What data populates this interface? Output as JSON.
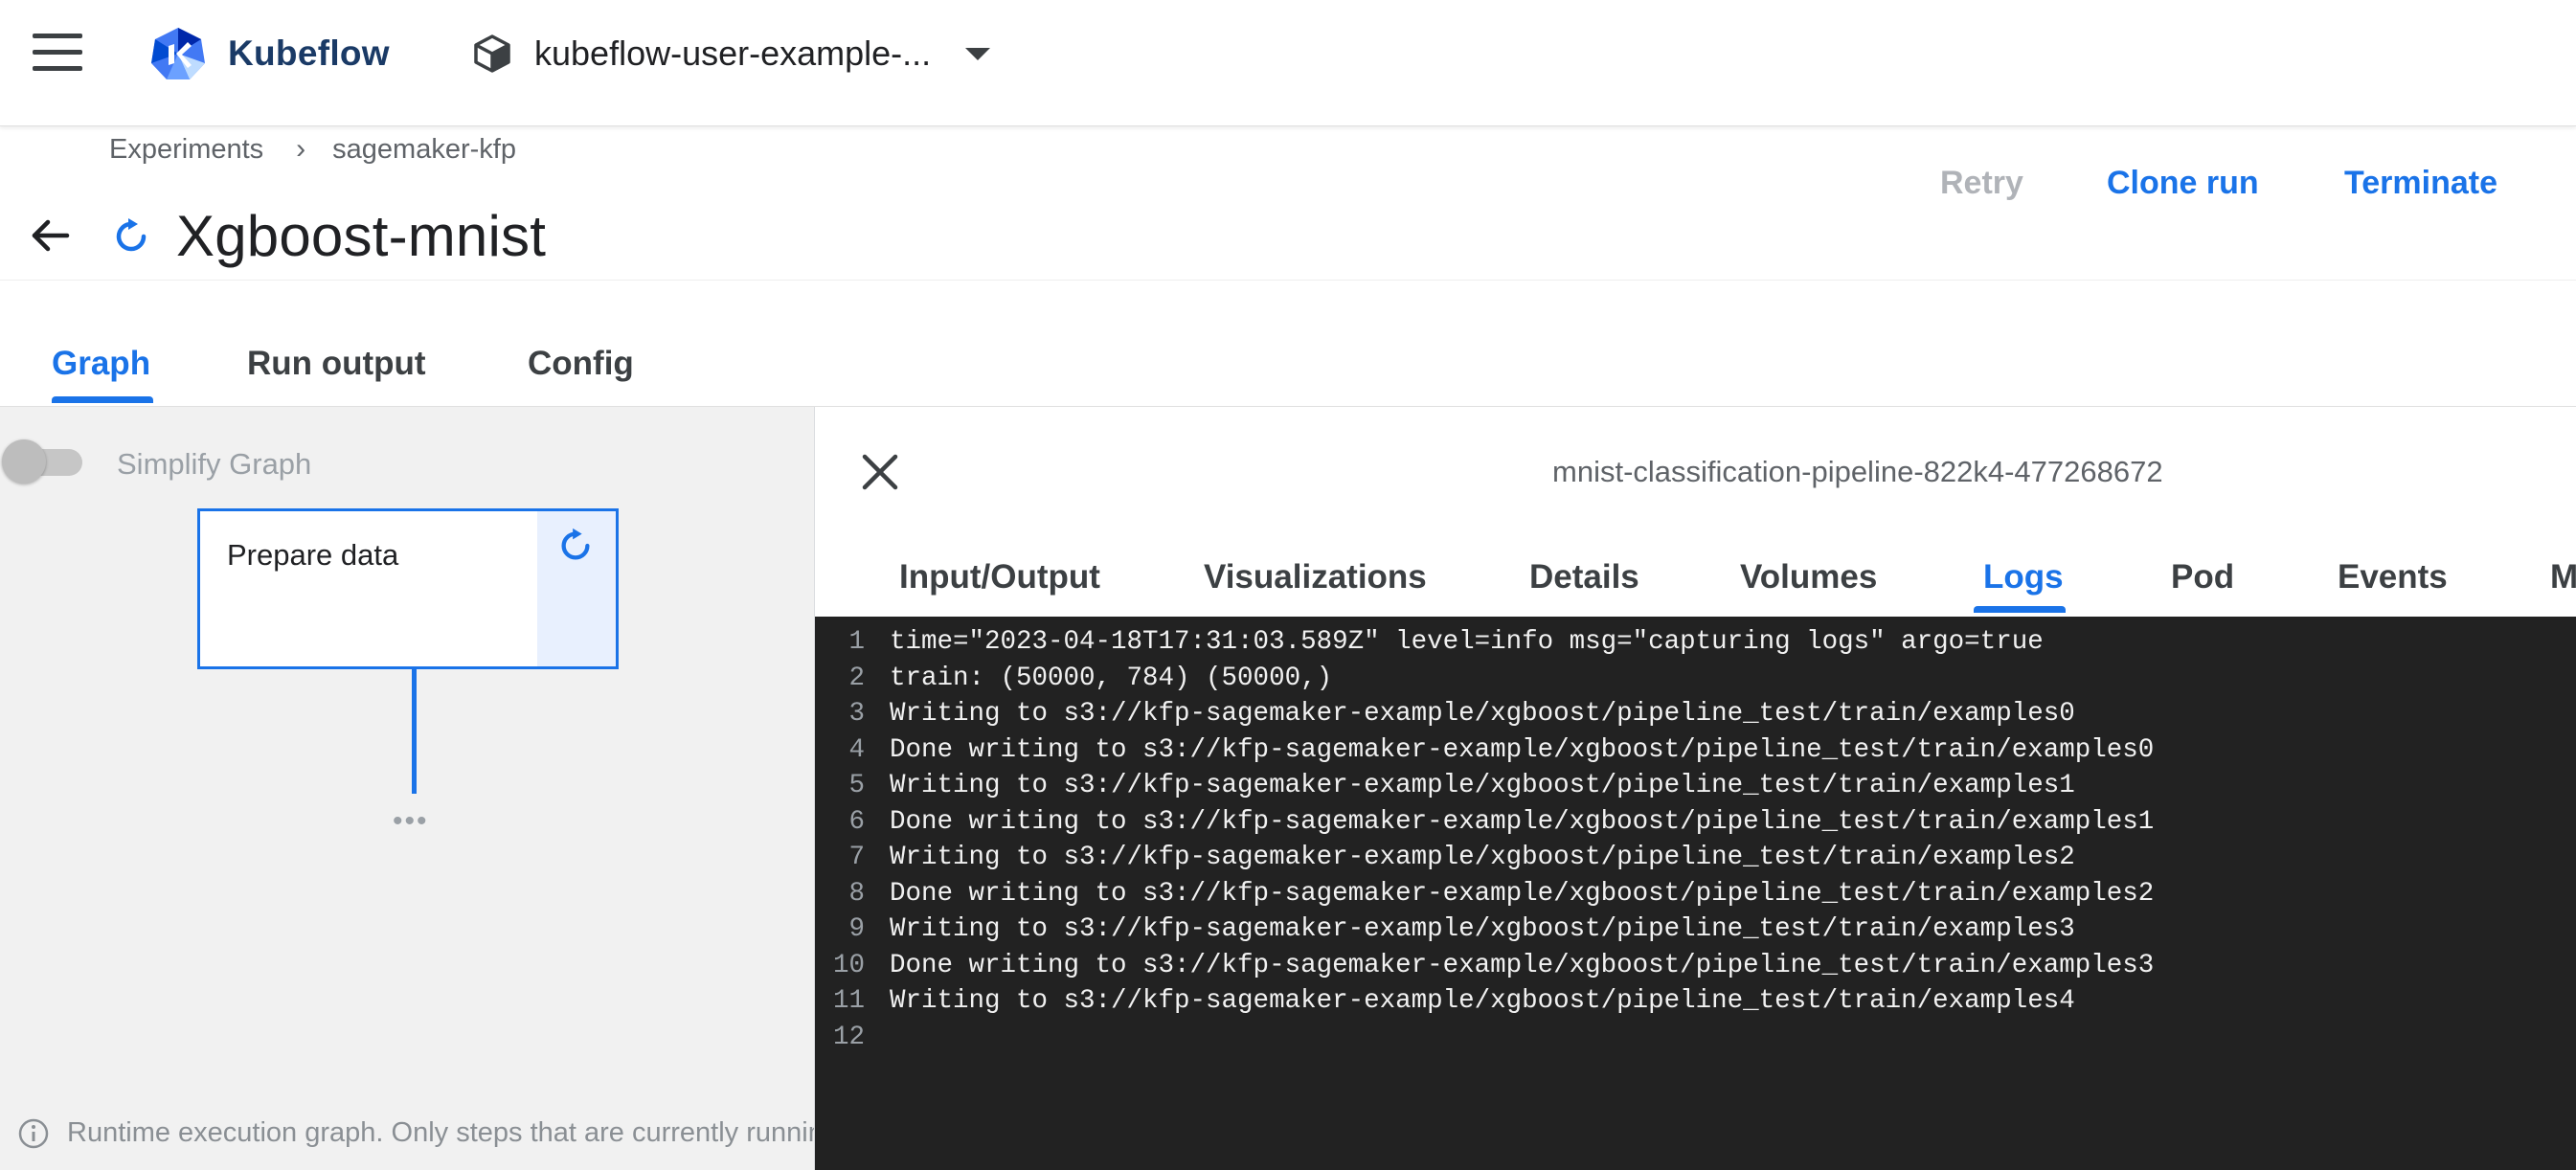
{
  "app": {
    "brand": "Kubeflow",
    "namespace": "kubeflow-user-example-..."
  },
  "breadcrumb": {
    "items": [
      "Experiments",
      "sagemaker-kfp"
    ],
    "separator": "›"
  },
  "run": {
    "title": "Xgboost-mnist",
    "status": "running"
  },
  "actions": {
    "retry": "Retry",
    "clone": "Clone run",
    "terminate": "Terminate"
  },
  "tabs": [
    {
      "label": "Graph",
      "active": true
    },
    {
      "label": "Run output",
      "active": false
    },
    {
      "label": "Config",
      "active": false
    }
  ],
  "graph": {
    "simplify_label": "Simplify Graph",
    "simplify_on": false,
    "node_label": "Prepare data",
    "more": "•••",
    "note": "Runtime execution graph. Only steps that are currently running or have already completed are shown."
  },
  "panel": {
    "run_id": "mnist-classification-pipeline-822k4-477268672",
    "tabs": [
      "Input/Output",
      "Visualizations",
      "Details",
      "Volumes",
      "Logs",
      "Pod",
      "Events",
      "M"
    ],
    "active_tab": "Logs"
  },
  "logs": [
    {
      "n": "1",
      "text": "time=\"2023-04-18T17:31:03.589Z\" level=info msg=\"capturing logs\" argo=true"
    },
    {
      "n": "2",
      "text": "train: (50000, 784) (50000,)"
    },
    {
      "n": "3",
      "text": "Writing to s3://kfp-sagemaker-example/xgboost/pipeline_test/train/examples0"
    },
    {
      "n": "4",
      "text": "Done writing to s3://kfp-sagemaker-example/xgboost/pipeline_test/train/examples0"
    },
    {
      "n": "5",
      "text": "Writing to s3://kfp-sagemaker-example/xgboost/pipeline_test/train/examples1"
    },
    {
      "n": "6",
      "text": "Done writing to s3://kfp-sagemaker-example/xgboost/pipeline_test/train/examples1"
    },
    {
      "n": "7",
      "text": "Writing to s3://kfp-sagemaker-example/xgboost/pipeline_test/train/examples2"
    },
    {
      "n": "8",
      "text": "Done writing to s3://kfp-sagemaker-example/xgboost/pipeline_test/train/examples2"
    },
    {
      "n": "9",
      "text": "Writing to s3://kfp-sagemaker-example/xgboost/pipeline_test/train/examples3"
    },
    {
      "n": "10",
      "text": "Done writing to s3://kfp-sagemaker-example/xgboost/pipeline_test/train/examples3"
    },
    {
      "n": "11",
      "text": "Writing to s3://kfp-sagemaker-example/xgboost/pipeline_test/train/examples4"
    },
    {
      "n": "12",
      "text": ""
    }
  ],
  "colors": {
    "accent": "#1a73e8",
    "brand_text": "#1a3a66",
    "log_background": "#222222",
    "disabled": "#b0b3b8"
  }
}
